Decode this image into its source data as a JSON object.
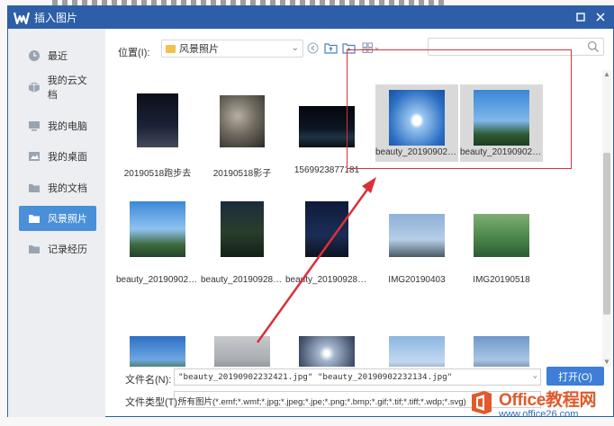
{
  "dialog": {
    "title": "插入图片",
    "accent_color": "#2d5fa8"
  },
  "sidebar": {
    "items": [
      {
        "label": "最近",
        "icon": "clock-icon"
      },
      {
        "label": "我的云文档",
        "icon": "cloud-doc-icon"
      },
      {
        "label": "我的电脑",
        "icon": "computer-icon"
      },
      {
        "label": "我的桌面",
        "icon": "desktop-icon"
      },
      {
        "label": "我的文档",
        "icon": "folder-icon"
      },
      {
        "label": "风景照片",
        "icon": "folder-icon",
        "active": true
      },
      {
        "label": "记录经历",
        "icon": "folder-icon"
      }
    ]
  },
  "toolbar": {
    "location_label": "位置(I):",
    "location_value": "风景照片",
    "search_placeholder": ""
  },
  "files": [
    {
      "name": "20190518跑步去",
      "theme": "night-street"
    },
    {
      "name": "20190518影子",
      "theme": "shadow"
    },
    {
      "name": "1569923877181",
      "theme": "night-lake"
    },
    {
      "name": "beauty_201909022...",
      "theme": "sky-cloud",
      "selected": true
    },
    {
      "name": "beauty_201909022...",
      "theme": "sky-trees",
      "selected": true
    },
    {
      "name": "beauty_201909022...",
      "theme": "sky-trees2"
    },
    {
      "name": "beauty_201909281...",
      "theme": "night-trees"
    },
    {
      "name": "beauty_201909281...",
      "theme": "night-sky"
    },
    {
      "name": "IMG20190403",
      "theme": "bare-tree"
    },
    {
      "name": "IMG20190518",
      "theme": "park"
    },
    {
      "name": "",
      "theme": "blue-trees"
    },
    {
      "name": "",
      "theme": "bridge"
    },
    {
      "name": "",
      "theme": "moon"
    },
    {
      "name": "",
      "theme": "lamp"
    },
    {
      "name": "",
      "theme": "branches"
    }
  ],
  "form": {
    "filename_label": "文件名(N):",
    "filename_value": "\"beauty_20190902232421.jpg\" \"beauty_20190902232134.jpg\"",
    "filetype_label": "文件类型(T):",
    "filetype_value": "所有图片(*.emf;*.wmf;*.jpg;*.jpeg;*.jpe;*.png;*.bmp;*.gif;*.tif;*.tiff;*.wdp;*.svg)",
    "open_label": "打开(O)"
  },
  "watermark": {
    "line1": "Office教程网",
    "line2": "www.office26.com"
  },
  "annotation_color": "#d9313b"
}
